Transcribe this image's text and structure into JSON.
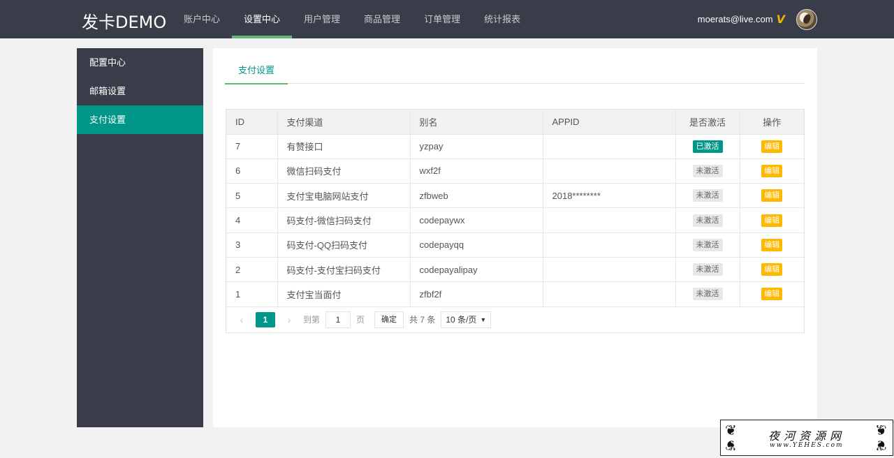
{
  "header": {
    "logo": "发卡DEMO",
    "nav": [
      "账户中心",
      "设置中心",
      "用户管理",
      "商品管理",
      "订单管理",
      "统计报表"
    ],
    "active_nav": 1,
    "user_email": "moerats@live.com",
    "vip_icon": "V"
  },
  "sidebar": {
    "items": [
      {
        "label": "配置中心",
        "active": false
      },
      {
        "label": "邮箱设置",
        "active": false
      },
      {
        "label": "支付设置",
        "active": true
      }
    ]
  },
  "main": {
    "tab": "支付设置",
    "table": {
      "headers": [
        "ID",
        "支付渠道",
        "别名",
        "APPID",
        "是否激活",
        "操作"
      ],
      "rows": [
        {
          "id": "7",
          "channel": "有赞接口",
          "alias": "yzpay",
          "appid": "",
          "status": "已激活",
          "active": true,
          "action": "编辑"
        },
        {
          "id": "6",
          "channel": "微信扫码支付",
          "alias": "wxf2f",
          "appid": "",
          "status": "未激活",
          "active": false,
          "action": "编辑"
        },
        {
          "id": "5",
          "channel": "支付宝电脑网站支付",
          "alias": "zfbweb",
          "appid": "2018********",
          "status": "未激活",
          "active": false,
          "action": "编辑"
        },
        {
          "id": "4",
          "channel": "码支付-微信扫码支付",
          "alias": "codepaywx",
          "appid": "",
          "status": "未激活",
          "active": false,
          "action": "编辑"
        },
        {
          "id": "3",
          "channel": "码支付-QQ扫码支付",
          "alias": "codepayqq",
          "appid": "",
          "status": "未激活",
          "active": false,
          "action": "编辑"
        },
        {
          "id": "2",
          "channel": "码支付-支付宝扫码支付",
          "alias": "codepayalipay",
          "appid": "",
          "status": "未激活",
          "active": false,
          "action": "编辑"
        },
        {
          "id": "1",
          "channel": "支付宝当面付",
          "alias": "zfbf2f",
          "appid": "",
          "status": "未激活",
          "active": false,
          "action": "编辑"
        }
      ]
    },
    "pager": {
      "prev_icon": "‹",
      "current_page": "1",
      "next_icon": "›",
      "goto_label": "到第",
      "goto_value": "1",
      "page_unit": "页",
      "confirm": "确定",
      "total": "共 7 条",
      "per_page": "10 条/页"
    }
  },
  "watermark": {
    "title": "夜河资源网",
    "url": "www.YEHES.com"
  },
  "colors": {
    "header_bg": "#393d49",
    "accent": "#009688",
    "nav_underline": "#5fb878",
    "edit_button": "#ffb800"
  }
}
